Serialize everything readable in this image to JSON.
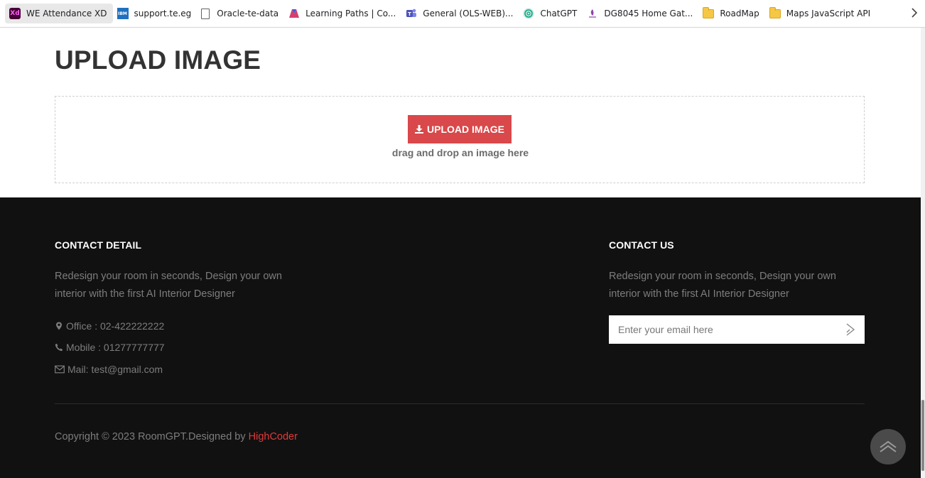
{
  "bookmarks": [
    {
      "label": "WE Attendance XD",
      "icon": "adobe-xd-icon",
      "badge": "Xd"
    },
    {
      "label": "support.te.eg",
      "icon": "ibm-icon",
      "badge": "IBM"
    },
    {
      "label": "Oracle-te-data",
      "icon": "document-icon"
    },
    {
      "label": "Learning Paths | Co...",
      "icon": "learning-paths-icon"
    },
    {
      "label": "General (OLS-WEB)...",
      "icon": "teams-icon"
    },
    {
      "label": "ChatGPT",
      "icon": "chatgpt-icon"
    },
    {
      "label": "DG8045 Home Gat...",
      "icon": "router-icon"
    },
    {
      "label": "RoadMap",
      "icon": "folder-icon"
    },
    {
      "label": "Maps JavaScript API",
      "icon": "folder-icon"
    }
  ],
  "upload": {
    "title": "UPLOAD IMAGE",
    "button_label": "UPLOAD IMAGE",
    "hint": "drag and drop an image here"
  },
  "footer": {
    "contact_detail": {
      "heading": "CONTACT DETAIL",
      "description": "Redesign your room in seconds, Design your own interior with the first AI Interior Designer",
      "office": "Office : 02-422222222",
      "mobile": "Mobile : 01277777777",
      "mail": "Mail: test@gmail.com"
    },
    "contact_us": {
      "heading": "CONTACT US",
      "description": "Redesign your room in seconds, Design your own interior with the first AI Interior Designer",
      "email_placeholder": "Enter your email here"
    },
    "copyright_prefix": "Copyright © 2023 RoomGPT.Designed by ",
    "copyright_brand": "HighCoder"
  },
  "colors": {
    "accent": "#d9484a",
    "footer_bg": "#111111",
    "brand_link": "#e03a3a"
  }
}
